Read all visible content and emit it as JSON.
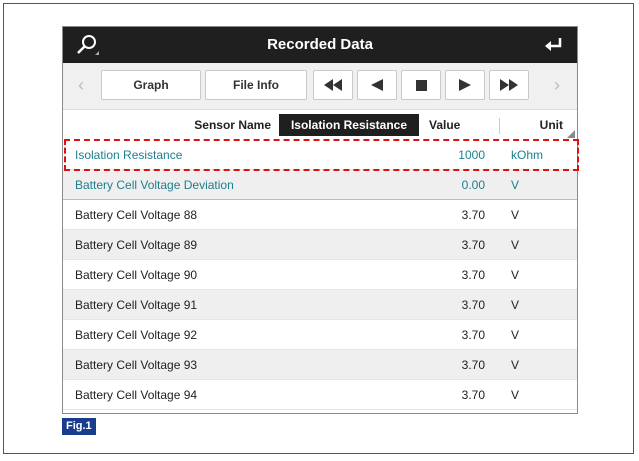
{
  "window": {
    "title": "Recorded Data"
  },
  "icons": {
    "search": "search-icon",
    "back": "back-arrow-icon"
  },
  "toolbar": {
    "graph_label": "Graph",
    "fileinfo_label": "File Info"
  },
  "header": {
    "sensor_name": "Sensor Name",
    "selected_sensor": "Isolation Resistance",
    "value": "Value",
    "unit": "Unit"
  },
  "rows": [
    {
      "name": "Isolation Resistance",
      "value": "1000",
      "unit": "kOhm"
    },
    {
      "name": "Battery Cell Voltage Deviation",
      "value": "0.00",
      "unit": "V"
    },
    {
      "name": "Battery Cell Voltage 88",
      "value": "3.70",
      "unit": "V"
    },
    {
      "name": "Battery Cell Voltage 89",
      "value": "3.70",
      "unit": "V"
    },
    {
      "name": "Battery Cell Voltage 90",
      "value": "3.70",
      "unit": "V"
    },
    {
      "name": "Battery Cell Voltage 91",
      "value": "3.70",
      "unit": "V"
    },
    {
      "name": "Battery Cell Voltage 92",
      "value": "3.70",
      "unit": "V"
    },
    {
      "name": "Battery Cell Voltage 93",
      "value": "3.70",
      "unit": "V"
    },
    {
      "name": "Battery Cell Voltage 94",
      "value": "3.70",
      "unit": "V"
    }
  ],
  "figure_label": "Fig.1",
  "colors": {
    "titlebar": "#1f1f1f",
    "teal_text": "#1d7f8c",
    "highlight": "#dd1111",
    "fig_badge": "#1a3c8c"
  }
}
